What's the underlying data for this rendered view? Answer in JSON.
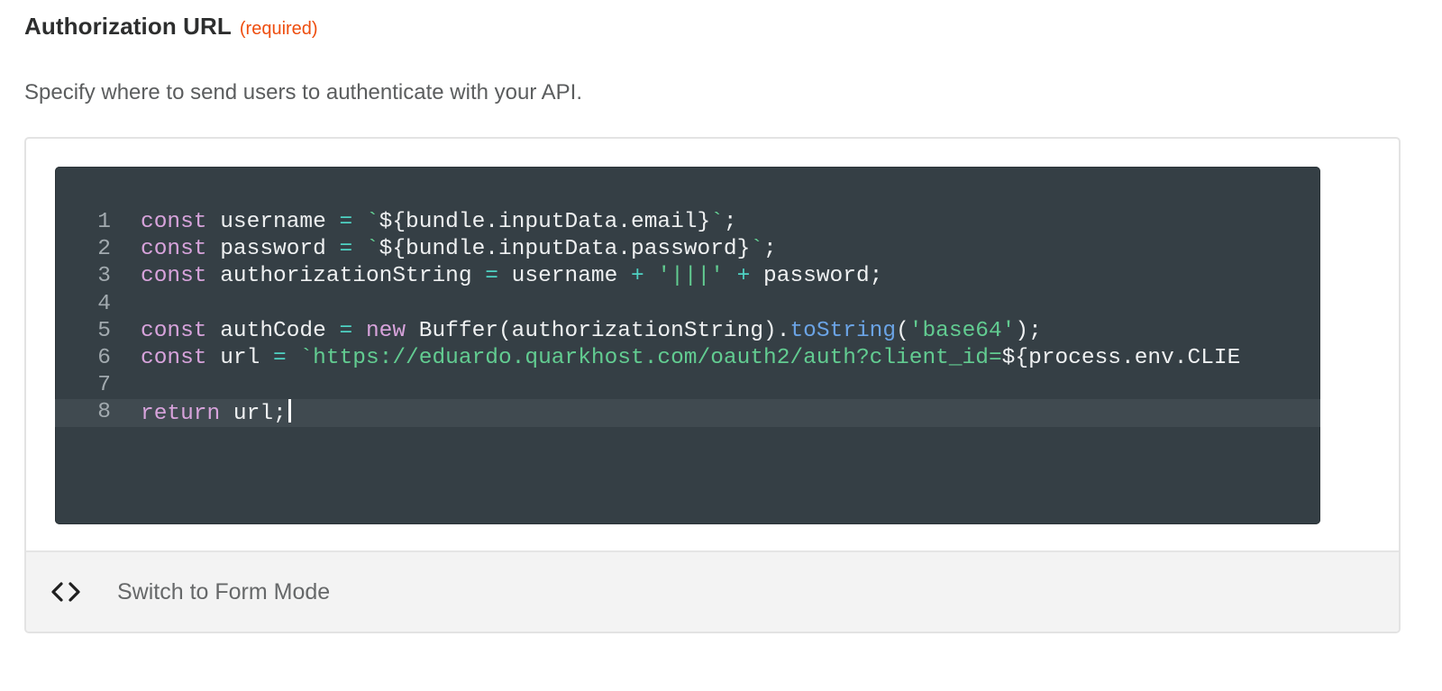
{
  "field": {
    "label": "Authorization URL",
    "required_tag": "(required)",
    "help_text": "Specify where to send users to authenticate with your API."
  },
  "editor": {
    "active_line": 8,
    "lines": [
      {
        "number": "1",
        "tokens": [
          {
            "text": "const",
            "kind": "kw"
          },
          {
            "text": " username ",
            "kind": "plain"
          },
          {
            "text": "=",
            "kind": "op"
          },
          {
            "text": " ",
            "kind": "plain"
          },
          {
            "text": "`",
            "kind": "str"
          },
          {
            "text": "${bundle.inputData.email}",
            "kind": "plain"
          },
          {
            "text": "`",
            "kind": "str"
          },
          {
            "text": ";",
            "kind": "plain"
          }
        ]
      },
      {
        "number": "2",
        "tokens": [
          {
            "text": "const",
            "kind": "kw"
          },
          {
            "text": " password ",
            "kind": "plain"
          },
          {
            "text": "=",
            "kind": "op"
          },
          {
            "text": " ",
            "kind": "plain"
          },
          {
            "text": "`",
            "kind": "str"
          },
          {
            "text": "${bundle.inputData.password}",
            "kind": "plain"
          },
          {
            "text": "`",
            "kind": "str"
          },
          {
            "text": ";",
            "kind": "plain"
          }
        ]
      },
      {
        "number": "3",
        "tokens": [
          {
            "text": "const",
            "kind": "kw"
          },
          {
            "text": " authorizationString ",
            "kind": "plain"
          },
          {
            "text": "=",
            "kind": "op"
          },
          {
            "text": " username ",
            "kind": "plain"
          },
          {
            "text": "+",
            "kind": "op"
          },
          {
            "text": " ",
            "kind": "plain"
          },
          {
            "text": "'|||'",
            "kind": "str"
          },
          {
            "text": " ",
            "kind": "plain"
          },
          {
            "text": "+",
            "kind": "op"
          },
          {
            "text": " password;",
            "kind": "plain"
          }
        ]
      },
      {
        "number": "4",
        "tokens": []
      },
      {
        "number": "5",
        "tokens": [
          {
            "text": "const",
            "kind": "kw"
          },
          {
            "text": " authCode ",
            "kind": "plain"
          },
          {
            "text": "=",
            "kind": "op"
          },
          {
            "text": " ",
            "kind": "plain"
          },
          {
            "text": "new",
            "kind": "kw"
          },
          {
            "text": " Buffer(authorizationString).",
            "kind": "plain"
          },
          {
            "text": "toString",
            "kind": "fn"
          },
          {
            "text": "(",
            "kind": "plain"
          },
          {
            "text": "'base64'",
            "kind": "str"
          },
          {
            "text": ");",
            "kind": "plain"
          }
        ]
      },
      {
        "number": "6",
        "tokens": [
          {
            "text": "const",
            "kind": "kw"
          },
          {
            "text": " url ",
            "kind": "plain"
          },
          {
            "text": "=",
            "kind": "op"
          },
          {
            "text": " ",
            "kind": "plain"
          },
          {
            "text": "`https://eduardo.quarkhost.com/oauth2/auth?client_id=",
            "kind": "str"
          },
          {
            "text": "${process.env.CLIE",
            "kind": "plain"
          }
        ]
      },
      {
        "number": "7",
        "tokens": []
      },
      {
        "number": "8",
        "tokens": [
          {
            "text": "return",
            "kind": "kw"
          },
          {
            "text": " url;",
            "kind": "plain"
          }
        ]
      }
    ]
  },
  "footer": {
    "icon": "code-brackets-icon",
    "switch_label": "Switch to Form Mode"
  },
  "colors": {
    "required": "#ee4d0e",
    "editor_background": "#353f45",
    "active_line_background": "#404a50",
    "keyword": "#d7a3db",
    "operator": "#4fd2c3",
    "string": "#62cc91",
    "function": "#6ba4e6"
  }
}
